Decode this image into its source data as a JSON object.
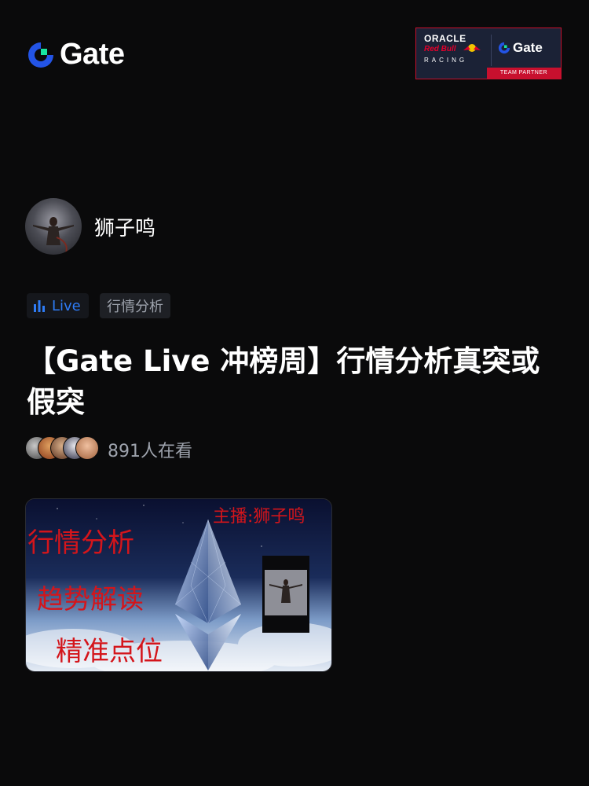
{
  "header": {
    "brand": "Gate",
    "partner": {
      "oracle": "ORACLE",
      "red_bull": "Red Bull",
      "racing": "RACING",
      "gate": "Gate",
      "tag": "TEAM PARTNER"
    }
  },
  "author": {
    "name": "狮子鸣"
  },
  "tags": {
    "live": "Live",
    "category": "行情分析"
  },
  "stream": {
    "title": "【Gate Live 冲榜周】行情分析真突或假突",
    "viewer_count": "891人在看"
  },
  "thumbnail": {
    "host": "主播:狮子鸣",
    "line1": "行情分析",
    "line2": "趋势解读",
    "line3": "精准点位"
  },
  "colors": {
    "accent_blue": "#2e7cf6",
    "brand_green": "#17e5a1",
    "thumbnail_text_red": "#d4151b",
    "background": "#0a0a0b"
  }
}
